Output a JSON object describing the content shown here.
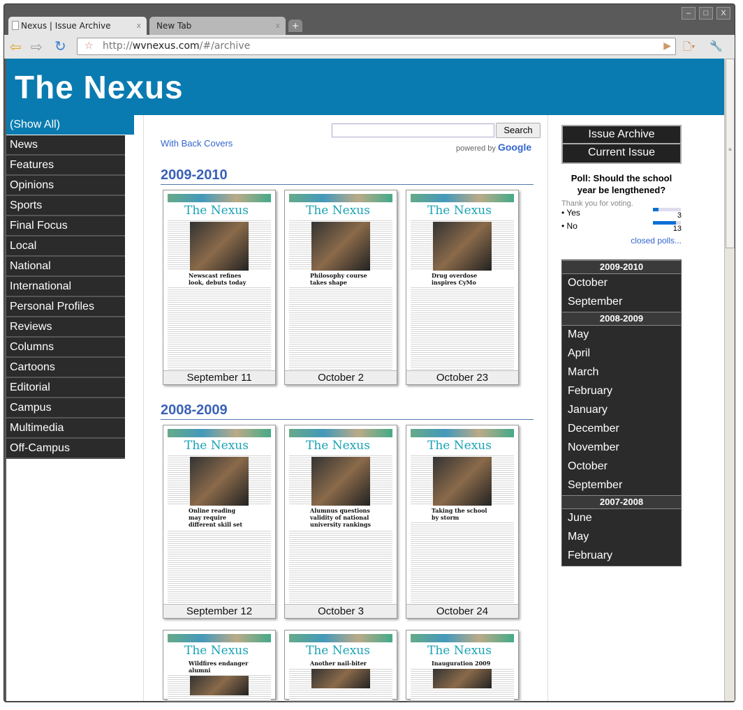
{
  "browser": {
    "tabs": [
      {
        "title": "Nexus | Issue Archive"
      },
      {
        "title": "New Tab"
      }
    ],
    "url_scheme": "http://",
    "url_host": "wvnexus.com",
    "url_path": "/#/archive",
    "close": "x",
    "new_tab": "+",
    "win_min": "–",
    "win_max": "□",
    "win_close": "X"
  },
  "site": {
    "title": "The Nexus"
  },
  "nav": {
    "show_all": "(Show All)",
    "items": [
      "News",
      "Features",
      "Opinions",
      "Sports",
      "Final Focus",
      "Local",
      "National",
      "International",
      "Personal Profiles",
      "Reviews",
      "Columns",
      "Cartoons",
      "Editorial",
      "Campus",
      "Multimedia",
      "Off-Campus"
    ]
  },
  "search": {
    "button": "Search",
    "powered": "powered by",
    "google": "Google"
  },
  "with_back_covers": "With Back Covers",
  "masthead": {
    "the": "The ",
    "nexus": "Nexus"
  },
  "sections": [
    {
      "year": "2009-2010",
      "issues": [
        {
          "date": "September 11",
          "headline": "Newscast refines look, debuts today"
        },
        {
          "date": "October 2",
          "headline": "Philosophy course takes shape"
        },
        {
          "date": "October 23",
          "headline": "Drug overdose inspires CyMo"
        }
      ]
    },
    {
      "year": "2008-2009",
      "issues": [
        {
          "date": "September 12",
          "headline": "Online reading may require different skill set"
        },
        {
          "date": "October 3",
          "headline": "Alumnus questions validity of national university rankings"
        },
        {
          "date": "October 24",
          "headline": "Taking the school by storm"
        }
      ]
    },
    {
      "year": "",
      "issues": [
        {
          "date": "",
          "headline": "Wildfires endanger alumni"
        },
        {
          "date": "",
          "headline": "Another nail-biter"
        },
        {
          "date": "",
          "headline": "Inauguration 2009"
        }
      ]
    }
  ],
  "right": {
    "issue_archive": "Issue Archive",
    "current_issue": "Current Issue",
    "poll": {
      "question": "Poll: Should the school year be lengthened?",
      "thanks": "Thank you for voting.",
      "options": [
        {
          "label": "• Yes",
          "votes": "3",
          "fraction": 0.1875
        },
        {
          "label": "• No",
          "votes": "13",
          "fraction": 0.8125
        }
      ],
      "closed": "closed polls..."
    },
    "archive": [
      {
        "year": "2009-2010",
        "months": [
          "October",
          "September"
        ]
      },
      {
        "year": "2008-2009",
        "months": [
          "May",
          "April",
          "March",
          "February",
          "January",
          "December",
          "November",
          "October",
          "September"
        ]
      },
      {
        "year": "2007-2008",
        "months": [
          "June",
          "May",
          "February"
        ]
      }
    ]
  },
  "colors": {
    "brand": "#0a7bb0",
    "nav_bg": "#2b2b2b",
    "link": "#3366cc"
  }
}
